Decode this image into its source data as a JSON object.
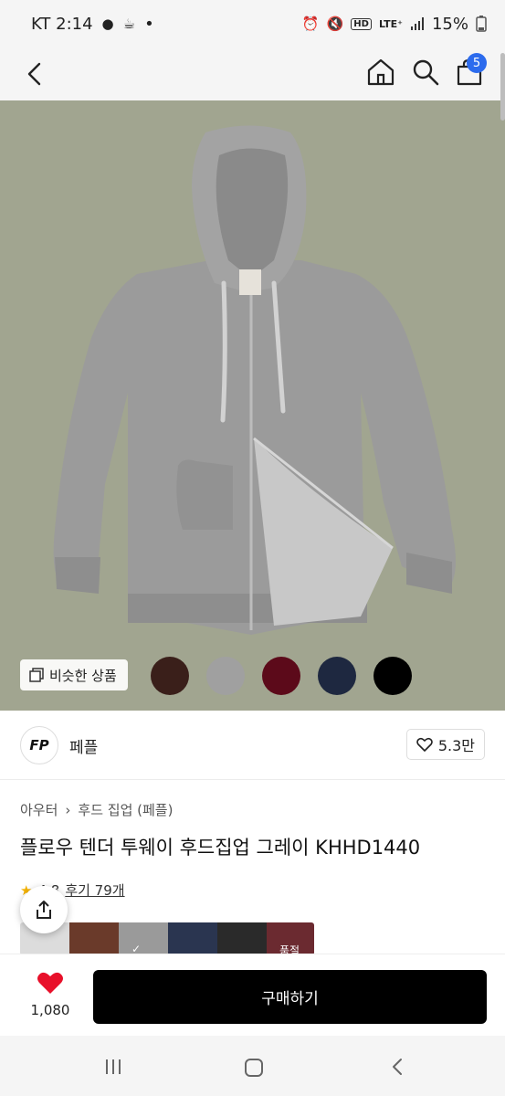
{
  "status": {
    "carrier_time": "KT 2:14",
    "dot": "•",
    "hd": "HD",
    "lte": "LTE⁺",
    "battery": "15%"
  },
  "header": {
    "cart_count": "5"
  },
  "gallery": {
    "similar_label": "비슷한 상품",
    "swatch_colors": [
      "#3a1f1a",
      "#a0a0a0",
      "#5c0a1a",
      "#1e2840",
      "#000000"
    ]
  },
  "brand": {
    "logo_text": "FP",
    "name": "페플",
    "likes": "5.3만"
  },
  "product": {
    "breadcrumb": [
      "아우터",
      "후드 집업 (페플)"
    ],
    "title": "플로우 텐더 투웨이 후드집업 그레이 KHHD1440",
    "rating_partial": "4.8",
    "review_link": "후기 79개",
    "thumb_badge": "품절"
  },
  "footer": {
    "heart_count": "1,080",
    "buy_label": "구매하기"
  }
}
